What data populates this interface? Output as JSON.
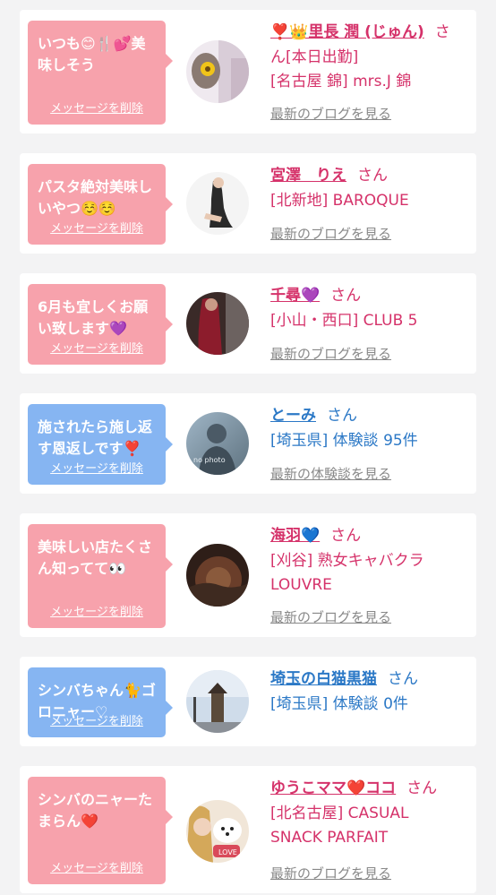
{
  "items": [
    {
      "message": "いつも😊🍴💕美\n味しそう",
      "delete_label": "メッセージを削除",
      "name": "❣️👑里長 潤 (じゅん)",
      "suffix": "さ",
      "shop": "ん[本日出勤]\n[名古屋 錦] mrs.J 錦",
      "link": "最新のブログを見る"
    },
    {
      "message": "パスタ絶対美味し\nいやつ☺️☺️",
      "delete_label": "メッセージを削除",
      "name": "宮澤　りえ",
      "suffix": "さん",
      "shop": "[北新地] BAROQUE",
      "link": "最新のブログを見る"
    },
    {
      "message": "6月も宜しくお願\nい致します💜",
      "delete_label": "メッセージを削除",
      "name": "千尋💜",
      "suffix": "さん",
      "shop": "[小山・西口] CLUB 5",
      "link": "最新のブログを見る"
    },
    {
      "message": "施されたら施し返\nす恩返しです❣️",
      "delete_label": "メッセージを削除",
      "name": "とーみ",
      "suffix": "さん",
      "shop": "[埼玉県] 体験談 95件",
      "link": "最新の体験談を見る",
      "photo_text": "no photo"
    },
    {
      "message": "美味しい店たくさ\nん知ってて👀",
      "delete_label": "メッセージを削除",
      "name": "海羽💙",
      "suffix": "さん",
      "shop": "[刈谷] 熟女キャバクラ\nLOUVRE",
      "link": "最新のブログを見る"
    },
    {
      "message": "シンバちゃん🐈ゴ\nロニャー♡",
      "delete_label": "メッセージを削除",
      "name": "埼玉の白猫黒猫",
      "suffix": "さん",
      "shop": "[埼玉県] 体験談 0件",
      "link": "最新の体験談を見る"
    },
    {
      "message": "シンバのニャーた\nまらん❤️",
      "delete_label": "メッセージを削除",
      "name": "ゆうこママ❤️ココ",
      "suffix": "さん",
      "shop": "[北名古屋] CASUAL\nSNACK PARFAIT",
      "link": "最新のブログを見る",
      "badge_text": "LOVE"
    }
  ],
  "colors": {
    "pink_bubble": "#f7a2ac",
    "blue_bubble": "#86b5f2",
    "cast_text": "#d5326a",
    "customer_text": "#2b78c6",
    "link_text": "#888888"
  }
}
